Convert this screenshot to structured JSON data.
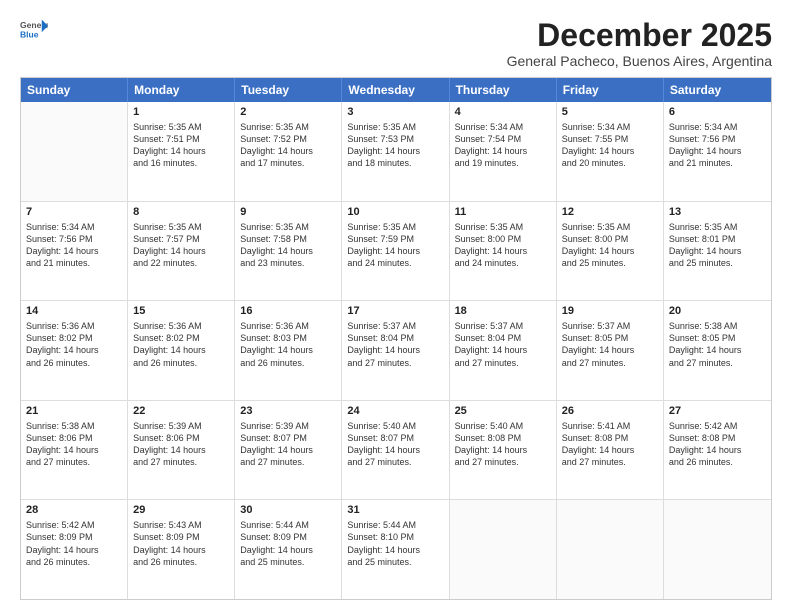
{
  "logo": {
    "general": "General",
    "blue": "Blue"
  },
  "title": "December 2025",
  "subtitle": "General Pacheco, Buenos Aires, Argentina",
  "calendar": {
    "headers": [
      "Sunday",
      "Monday",
      "Tuesday",
      "Wednesday",
      "Thursday",
      "Friday",
      "Saturday"
    ],
    "weeks": [
      [
        {
          "day": "",
          "info": ""
        },
        {
          "day": "1",
          "info": "Sunrise: 5:35 AM\nSunset: 7:51 PM\nDaylight: 14 hours\nand 16 minutes."
        },
        {
          "day": "2",
          "info": "Sunrise: 5:35 AM\nSunset: 7:52 PM\nDaylight: 14 hours\nand 17 minutes."
        },
        {
          "day": "3",
          "info": "Sunrise: 5:35 AM\nSunset: 7:53 PM\nDaylight: 14 hours\nand 18 minutes."
        },
        {
          "day": "4",
          "info": "Sunrise: 5:34 AM\nSunset: 7:54 PM\nDaylight: 14 hours\nand 19 minutes."
        },
        {
          "day": "5",
          "info": "Sunrise: 5:34 AM\nSunset: 7:55 PM\nDaylight: 14 hours\nand 20 minutes."
        },
        {
          "day": "6",
          "info": "Sunrise: 5:34 AM\nSunset: 7:56 PM\nDaylight: 14 hours\nand 21 minutes."
        }
      ],
      [
        {
          "day": "7",
          "info": "Sunrise: 5:34 AM\nSunset: 7:56 PM\nDaylight: 14 hours\nand 21 minutes."
        },
        {
          "day": "8",
          "info": "Sunrise: 5:35 AM\nSunset: 7:57 PM\nDaylight: 14 hours\nand 22 minutes."
        },
        {
          "day": "9",
          "info": "Sunrise: 5:35 AM\nSunset: 7:58 PM\nDaylight: 14 hours\nand 23 minutes."
        },
        {
          "day": "10",
          "info": "Sunrise: 5:35 AM\nSunset: 7:59 PM\nDaylight: 14 hours\nand 24 minutes."
        },
        {
          "day": "11",
          "info": "Sunrise: 5:35 AM\nSunset: 8:00 PM\nDaylight: 14 hours\nand 24 minutes."
        },
        {
          "day": "12",
          "info": "Sunrise: 5:35 AM\nSunset: 8:00 PM\nDaylight: 14 hours\nand 25 minutes."
        },
        {
          "day": "13",
          "info": "Sunrise: 5:35 AM\nSunset: 8:01 PM\nDaylight: 14 hours\nand 25 minutes."
        }
      ],
      [
        {
          "day": "14",
          "info": "Sunrise: 5:36 AM\nSunset: 8:02 PM\nDaylight: 14 hours\nand 26 minutes."
        },
        {
          "day": "15",
          "info": "Sunrise: 5:36 AM\nSunset: 8:02 PM\nDaylight: 14 hours\nand 26 minutes."
        },
        {
          "day": "16",
          "info": "Sunrise: 5:36 AM\nSunset: 8:03 PM\nDaylight: 14 hours\nand 26 minutes."
        },
        {
          "day": "17",
          "info": "Sunrise: 5:37 AM\nSunset: 8:04 PM\nDaylight: 14 hours\nand 27 minutes."
        },
        {
          "day": "18",
          "info": "Sunrise: 5:37 AM\nSunset: 8:04 PM\nDaylight: 14 hours\nand 27 minutes."
        },
        {
          "day": "19",
          "info": "Sunrise: 5:37 AM\nSunset: 8:05 PM\nDaylight: 14 hours\nand 27 minutes."
        },
        {
          "day": "20",
          "info": "Sunrise: 5:38 AM\nSunset: 8:05 PM\nDaylight: 14 hours\nand 27 minutes."
        }
      ],
      [
        {
          "day": "21",
          "info": "Sunrise: 5:38 AM\nSunset: 8:06 PM\nDaylight: 14 hours\nand 27 minutes."
        },
        {
          "day": "22",
          "info": "Sunrise: 5:39 AM\nSunset: 8:06 PM\nDaylight: 14 hours\nand 27 minutes."
        },
        {
          "day": "23",
          "info": "Sunrise: 5:39 AM\nSunset: 8:07 PM\nDaylight: 14 hours\nand 27 minutes."
        },
        {
          "day": "24",
          "info": "Sunrise: 5:40 AM\nSunset: 8:07 PM\nDaylight: 14 hours\nand 27 minutes."
        },
        {
          "day": "25",
          "info": "Sunrise: 5:40 AM\nSunset: 8:08 PM\nDaylight: 14 hours\nand 27 minutes."
        },
        {
          "day": "26",
          "info": "Sunrise: 5:41 AM\nSunset: 8:08 PM\nDaylight: 14 hours\nand 27 minutes."
        },
        {
          "day": "27",
          "info": "Sunrise: 5:42 AM\nSunset: 8:08 PM\nDaylight: 14 hours\nand 26 minutes."
        }
      ],
      [
        {
          "day": "28",
          "info": "Sunrise: 5:42 AM\nSunset: 8:09 PM\nDaylight: 14 hours\nand 26 minutes."
        },
        {
          "day": "29",
          "info": "Sunrise: 5:43 AM\nSunset: 8:09 PM\nDaylight: 14 hours\nand 26 minutes."
        },
        {
          "day": "30",
          "info": "Sunrise: 5:44 AM\nSunset: 8:09 PM\nDaylight: 14 hours\nand 25 minutes."
        },
        {
          "day": "31",
          "info": "Sunrise: 5:44 AM\nSunset: 8:10 PM\nDaylight: 14 hours\nand 25 minutes."
        },
        {
          "day": "",
          "info": ""
        },
        {
          "day": "",
          "info": ""
        },
        {
          "day": "",
          "info": ""
        }
      ]
    ]
  }
}
